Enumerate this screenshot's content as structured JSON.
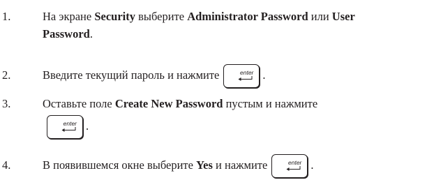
{
  "steps": [
    {
      "number": "1.",
      "lines": [
        [
          {
            "t": "На экране "
          },
          {
            "t": "Security",
            "b": true
          },
          {
            "t": " выберите "
          },
          {
            "t": "Administrator Password",
            "b": true
          },
          {
            "t": " или "
          },
          {
            "t": "User",
            "b": true
          }
        ],
        [
          {
            "t": "Password",
            "b": true
          },
          {
            "t": "."
          }
        ]
      ]
    },
    {
      "number": "2.",
      "lines": [
        [
          {
            "t": "Введите текущий пароль и нажмите"
          },
          {
            "key": true
          },
          {
            "t": "."
          }
        ]
      ]
    },
    {
      "number": "3.",
      "lines": [
        [
          {
            "t": "Оставьте поле "
          },
          {
            "t": "Create New Password",
            "b": true
          },
          {
            "t": " пустым и нажмите"
          }
        ],
        [
          {
            "key": true
          },
          {
            "t": "."
          }
        ]
      ]
    },
    {
      "number": "4.",
      "lines": [
        [
          {
            "t": "В появившемся окне выберите "
          },
          {
            "t": "Yes",
            "b": true
          },
          {
            "t": " и нажмите"
          },
          {
            "key": true
          },
          {
            "t": "."
          }
        ]
      ]
    }
  ],
  "key_label": "enter",
  "key_icon": "enter-arrow-icon"
}
